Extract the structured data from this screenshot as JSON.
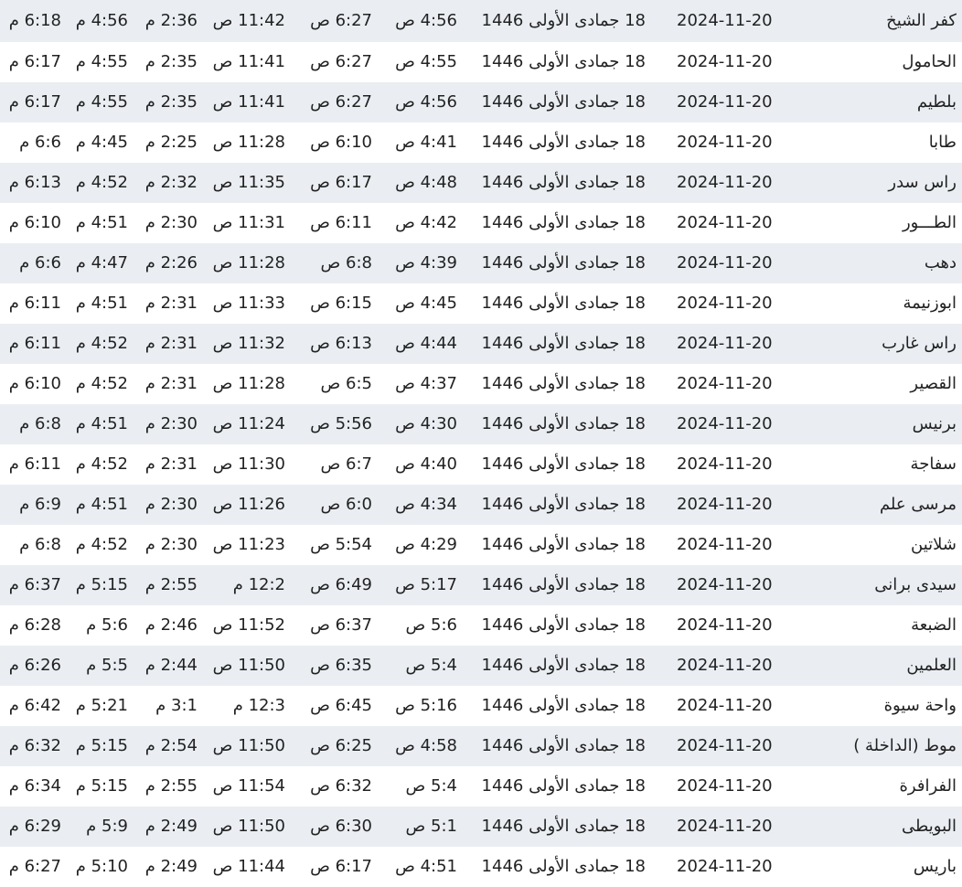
{
  "rows": [
    {
      "city": "كفر الشيخ",
      "gregorian": "2024-11-20",
      "hijri": "18 جمادى الأولى 1446",
      "fajr": "4:56 ص",
      "sunrise": "6:27 ص",
      "dhuhr": "11:42 ص",
      "asr": "2:36 م",
      "maghrib": "4:56 م",
      "isha": "6:18 م"
    },
    {
      "city": "الحامول",
      "gregorian": "2024-11-20",
      "hijri": "18 جمادى الأولى 1446",
      "fajr": "4:55 ص",
      "sunrise": "6:27 ص",
      "dhuhr": "11:41 ص",
      "asr": "2:35 م",
      "maghrib": "4:55 م",
      "isha": "6:17 م"
    },
    {
      "city": "بلطيم",
      "gregorian": "2024-11-20",
      "hijri": "18 جمادى الأولى 1446",
      "fajr": "4:56 ص",
      "sunrise": "6:27 ص",
      "dhuhr": "11:41 ص",
      "asr": "2:35 م",
      "maghrib": "4:55 م",
      "isha": "6:17 م"
    },
    {
      "city": "طابا",
      "gregorian": "2024-11-20",
      "hijri": "18 جمادى الأولى 1446",
      "fajr": "4:41 ص",
      "sunrise": "6:10 ص",
      "dhuhr": "11:28 ص",
      "asr": "2:25 م",
      "maghrib": "4:45 م",
      "isha": "6:6 م"
    },
    {
      "city": "راس سدر",
      "gregorian": "2024-11-20",
      "hijri": "18 جمادى الأولى 1446",
      "fajr": "4:48 ص",
      "sunrise": "6:17 ص",
      "dhuhr": "11:35 ص",
      "asr": "2:32 م",
      "maghrib": "4:52 م",
      "isha": "6:13 م"
    },
    {
      "city": "الطـــور",
      "gregorian": "2024-11-20",
      "hijri": "18 جمادى الأولى 1446",
      "fajr": "4:42 ص",
      "sunrise": "6:11 ص",
      "dhuhr": "11:31 ص",
      "asr": "2:30 م",
      "maghrib": "4:51 م",
      "isha": "6:10 م"
    },
    {
      "city": "دهب",
      "gregorian": "2024-11-20",
      "hijri": "18 جمادى الأولى 1446",
      "fajr": "4:39 ص",
      "sunrise": "6:8 ص",
      "dhuhr": "11:28 ص",
      "asr": "2:26 م",
      "maghrib": "4:47 م",
      "isha": "6:6 م"
    },
    {
      "city": "ابوزنيمة",
      "gregorian": "2024-11-20",
      "hijri": "18 جمادى الأولى 1446",
      "fajr": "4:45 ص",
      "sunrise": "6:15 ص",
      "dhuhr": "11:33 ص",
      "asr": "2:31 م",
      "maghrib": "4:51 م",
      "isha": "6:11 م"
    },
    {
      "city": "راس غارب",
      "gregorian": "2024-11-20",
      "hijri": "18 جمادى الأولى 1446",
      "fajr": "4:44 ص",
      "sunrise": "6:13 ص",
      "dhuhr": "11:32 ص",
      "asr": "2:31 م",
      "maghrib": "4:52 م",
      "isha": "6:11 م"
    },
    {
      "city": "القصير",
      "gregorian": "2024-11-20",
      "hijri": "18 جمادى الأولى 1446",
      "fajr": "4:37 ص",
      "sunrise": "6:5 ص",
      "dhuhr": "11:28 ص",
      "asr": "2:31 م",
      "maghrib": "4:52 م",
      "isha": "6:10 م"
    },
    {
      "city": "برنيس",
      "gregorian": "2024-11-20",
      "hijri": "18 جمادى الأولى 1446",
      "fajr": "4:30 ص",
      "sunrise": "5:56 ص",
      "dhuhr": "11:24 ص",
      "asr": "2:30 م",
      "maghrib": "4:51 م",
      "isha": "6:8 م"
    },
    {
      "city": "سفاجة",
      "gregorian": "2024-11-20",
      "hijri": "18 جمادى الأولى 1446",
      "fajr": "4:40 ص",
      "sunrise": "6:7 ص",
      "dhuhr": "11:30 ص",
      "asr": "2:31 م",
      "maghrib": "4:52 م",
      "isha": "6:11 م"
    },
    {
      "city": "مرسى علم",
      "gregorian": "2024-11-20",
      "hijri": "18 جمادى الأولى 1446",
      "fajr": "4:34 ص",
      "sunrise": "6:0 ص",
      "dhuhr": "11:26 ص",
      "asr": "2:30 م",
      "maghrib": "4:51 م",
      "isha": "6:9 م"
    },
    {
      "city": "شلاتين",
      "gregorian": "2024-11-20",
      "hijri": "18 جمادى الأولى 1446",
      "fajr": "4:29 ص",
      "sunrise": "5:54 ص",
      "dhuhr": "11:23 ص",
      "asr": "2:30 م",
      "maghrib": "4:52 م",
      "isha": "6:8 م"
    },
    {
      "city": "سيدى برانى",
      "gregorian": "2024-11-20",
      "hijri": "18 جمادى الأولى 1446",
      "fajr": "5:17 ص",
      "sunrise": "6:49 ص",
      "dhuhr": "12:2 م",
      "asr": "2:55 م",
      "maghrib": "5:15 م",
      "isha": "6:37 م"
    },
    {
      "city": "الضبعة",
      "gregorian": "2024-11-20",
      "hijri": "18 جمادى الأولى 1446",
      "fajr": "5:6 ص",
      "sunrise": "6:37 ص",
      "dhuhr": "11:52 ص",
      "asr": "2:46 م",
      "maghrib": "5:6 م",
      "isha": "6:28 م"
    },
    {
      "city": "العلمين",
      "gregorian": "2024-11-20",
      "hijri": "18 جمادى الأولى 1446",
      "fajr": "5:4 ص",
      "sunrise": "6:35 ص",
      "dhuhr": "11:50 ص",
      "asr": "2:44 م",
      "maghrib": "5:5 م",
      "isha": "6:26 م"
    },
    {
      "city": "واحة سيوة",
      "gregorian": "2024-11-20",
      "hijri": "18 جمادى الأولى 1446",
      "fajr": "5:16 ص",
      "sunrise": "6:45 ص",
      "dhuhr": "12:3 م",
      "asr": "3:1 م",
      "maghrib": "5:21 م",
      "isha": "6:42 م"
    },
    {
      "city": "موط (الداخلة )",
      "gregorian": "2024-11-20",
      "hijri": "18 جمادى الأولى 1446",
      "fajr": "4:58 ص",
      "sunrise": "6:25 ص",
      "dhuhr": "11:50 ص",
      "asr": "2:54 م",
      "maghrib": "5:15 م",
      "isha": "6:32 م"
    },
    {
      "city": "الفرافرة",
      "gregorian": "2024-11-20",
      "hijri": "18 جمادى الأولى 1446",
      "fajr": "5:4 ص",
      "sunrise": "6:32 ص",
      "dhuhr": "11:54 ص",
      "asr": "2:55 م",
      "maghrib": "5:15 م",
      "isha": "6:34 م"
    },
    {
      "city": "البويطى",
      "gregorian": "2024-11-20",
      "hijri": "18 جمادى الأولى 1446",
      "fajr": "5:1 ص",
      "sunrise": "6:30 ص",
      "dhuhr": "11:50 ص",
      "asr": "2:49 م",
      "maghrib": "5:9 م",
      "isha": "6:29 م"
    },
    {
      "city": "باريس",
      "gregorian": "2024-11-20",
      "hijri": "18 جمادى الأولى 1446",
      "fajr": "4:51 ص",
      "sunrise": "6:17 ص",
      "dhuhr": "11:44 ص",
      "asr": "2:49 م",
      "maghrib": "5:10 م",
      "isha": "6:27 م"
    }
  ]
}
